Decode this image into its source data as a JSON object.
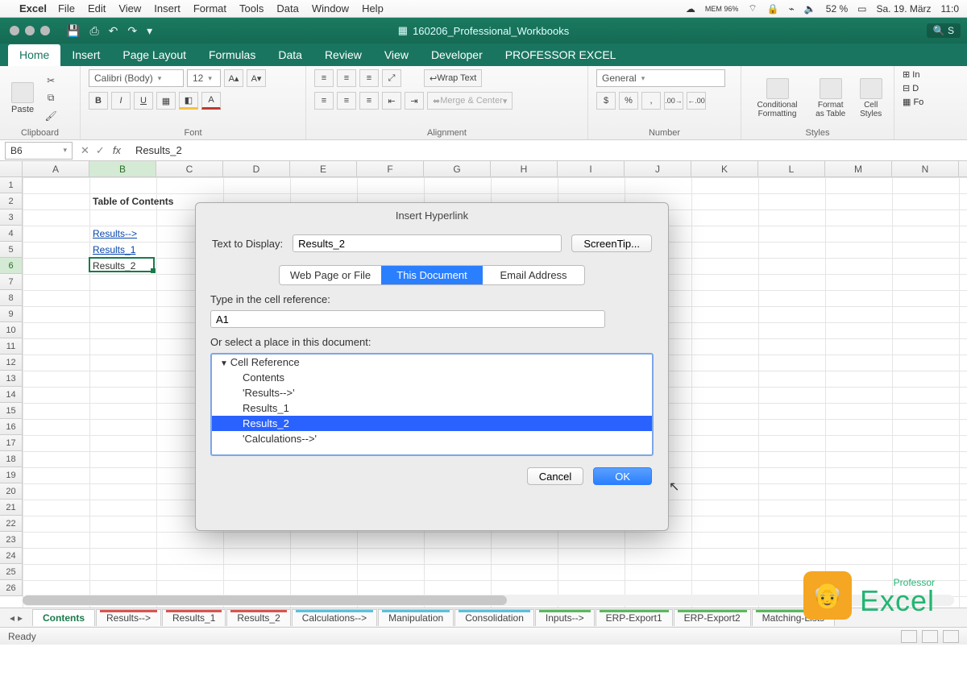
{
  "mac_menu": {
    "app": "Excel",
    "items": [
      "File",
      "Edit",
      "View",
      "Insert",
      "Format",
      "Tools",
      "Data",
      "Window",
      "Help"
    ],
    "right": {
      "mem": "MEM 96%",
      "battery": "52 %",
      "date": "Sa. 19. März",
      "time": "11:0"
    }
  },
  "titlebar": {
    "doc": "160206_Professional_Workbooks",
    "search": "S"
  },
  "ribbon_tabs": [
    "Home",
    "Insert",
    "Page Layout",
    "Formulas",
    "Data",
    "Review",
    "View",
    "Developer",
    "PROFESSOR EXCEL"
  ],
  "ribbon_active": "Home",
  "ribbon": {
    "clipboard": {
      "paste": "Paste",
      "label": "Clipboard"
    },
    "font": {
      "name": "Calibri (Body)",
      "size": "12",
      "label": "Font",
      "buttons": [
        "B",
        "I",
        "U"
      ]
    },
    "alignment": {
      "wrap": "Wrap Text",
      "merge": "Merge & Center",
      "label": "Alignment"
    },
    "number": {
      "format": "General",
      "label": "Number"
    },
    "styles": {
      "cf": "Conditional Formatting",
      "fat": "Format as Table",
      "cs": "Cell Styles",
      "label": "Styles"
    },
    "cells": {
      "ins": "In",
      "del": "D",
      "fmt": "Fo"
    }
  },
  "formula_bar": {
    "namebox": "B6",
    "formula": "Results_2"
  },
  "columns": [
    "A",
    "B",
    "C",
    "D",
    "E",
    "F",
    "G",
    "H",
    "I",
    "J",
    "K",
    "L",
    "M",
    "N"
  ],
  "sel_col": "B",
  "sel_row": 6,
  "cells": {
    "B2": {
      "v": "Table of Contents",
      "bold": true
    },
    "B4": {
      "v": "Results-->",
      "link": true
    },
    "B5": {
      "v": "Results_1",
      "link": true
    },
    "B6": {
      "v": "Results_2"
    }
  },
  "row_count": 26,
  "sheet_tabs": [
    {
      "name": "Contents",
      "active": true,
      "color": ""
    },
    {
      "name": "Results-->",
      "color": "#d9534f"
    },
    {
      "name": "Results_1",
      "color": "#d9534f"
    },
    {
      "name": "Results_2",
      "color": "#d9534f"
    },
    {
      "name": "Calculations-->",
      "color": "#5bc0de"
    },
    {
      "name": "Manipulation",
      "color": "#5bc0de"
    },
    {
      "name": "Consolidation",
      "color": "#5bc0de"
    },
    {
      "name": "Inputs-->",
      "color": "#5cb85c"
    },
    {
      "name": "ERP-Export1",
      "color": "#5cb85c"
    },
    {
      "name": "ERP-Export2",
      "color": "#5cb85c"
    },
    {
      "name": "Matching-Lists",
      "color": "#5cb85c"
    }
  ],
  "status": {
    "left": "Ready"
  },
  "dialog": {
    "title": "Insert Hyperlink",
    "text_to_display_label": "Text to Display:",
    "text_to_display": "Results_2",
    "screentip": "ScreenTip...",
    "tabs": [
      "Web Page or File",
      "This Document",
      "Email Address"
    ],
    "tab_active": "This Document",
    "cellref_label": "Type in the cell reference:",
    "cellref": "A1",
    "place_label": "Or select a place in this document:",
    "list_header": "Cell Reference",
    "list": [
      "Contents",
      "'Results-->'",
      "Results_1",
      "Results_2",
      "'Calculations-->'"
    ],
    "list_selected": "Results_2",
    "cancel": "Cancel",
    "ok": "OK"
  },
  "logo": {
    "prof": "Professor",
    "excel": "Excel"
  }
}
